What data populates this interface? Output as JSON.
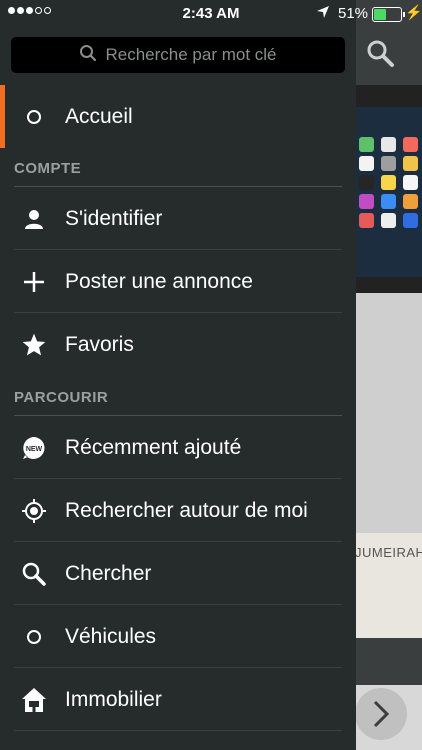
{
  "status": {
    "time": "2:43 AM",
    "battery_pct": "51%",
    "battery_level": 0.51
  },
  "search": {
    "placeholder": "Recherche par mot clé"
  },
  "menu": {
    "home": "Accueil",
    "sections": [
      {
        "header": "COMPTE",
        "items": [
          {
            "label": "S'identifier",
            "icon": "user-icon"
          },
          {
            "label": "Poster une annonce",
            "icon": "plus-icon"
          },
          {
            "label": "Favoris",
            "icon": "star-icon"
          }
        ]
      },
      {
        "header": "PARCOURIR",
        "items": [
          {
            "label": "Récemment ajouté",
            "icon": "new-badge-icon"
          },
          {
            "label": "Rechercher autour de moi",
            "icon": "location-target-icon"
          },
          {
            "label": "Chercher",
            "icon": "search-icon"
          },
          {
            "label": "Véhicules",
            "icon": "circle-icon"
          },
          {
            "label": "Immobilier",
            "icon": "house-icon"
          }
        ]
      }
    ]
  },
  "background": {
    "map_label": "JUMEIRAH"
  },
  "colors": {
    "accent": "#f26f21",
    "drawer_bg": "#262b2b"
  }
}
